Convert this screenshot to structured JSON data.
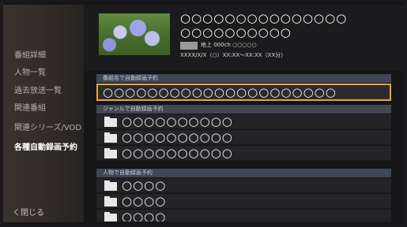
{
  "sidebar": {
    "items": [
      {
        "label": "番組詳細"
      },
      {
        "label": "人物一覧"
      },
      {
        "label": "過去放送一覧"
      },
      {
        "label": "関連番組"
      },
      {
        "label": "関連シリーズ/VOD"
      },
      {
        "label": "各種自動録画予約"
      }
    ],
    "close_label": "く閉じる"
  },
  "program": {
    "title_line1": "○○○○○○○○○○○○○○○",
    "title_line2": "○○○○○○○○○○",
    "channel": "地上 000ch ○○○○○",
    "air_time": "XXXX/X/X（○）XX:XX〜XX:XX（XX分）"
  },
  "sections": {
    "title_reservation": {
      "header": "番組名で自動録画予約",
      "item": "○○○○○○○○○○○○○○○○○○○○○"
    },
    "genre_reservation": {
      "header": "ジャンルで自動録画予約",
      "items": [
        "○○○○○○○○○○",
        "○○○○○○○○○○",
        "○○○○○○○○○○"
      ]
    },
    "person_reservation": {
      "header": "人物で自動録画予約",
      "items": [
        "○○○○",
        "○○○○",
        "○○○○"
      ]
    }
  }
}
